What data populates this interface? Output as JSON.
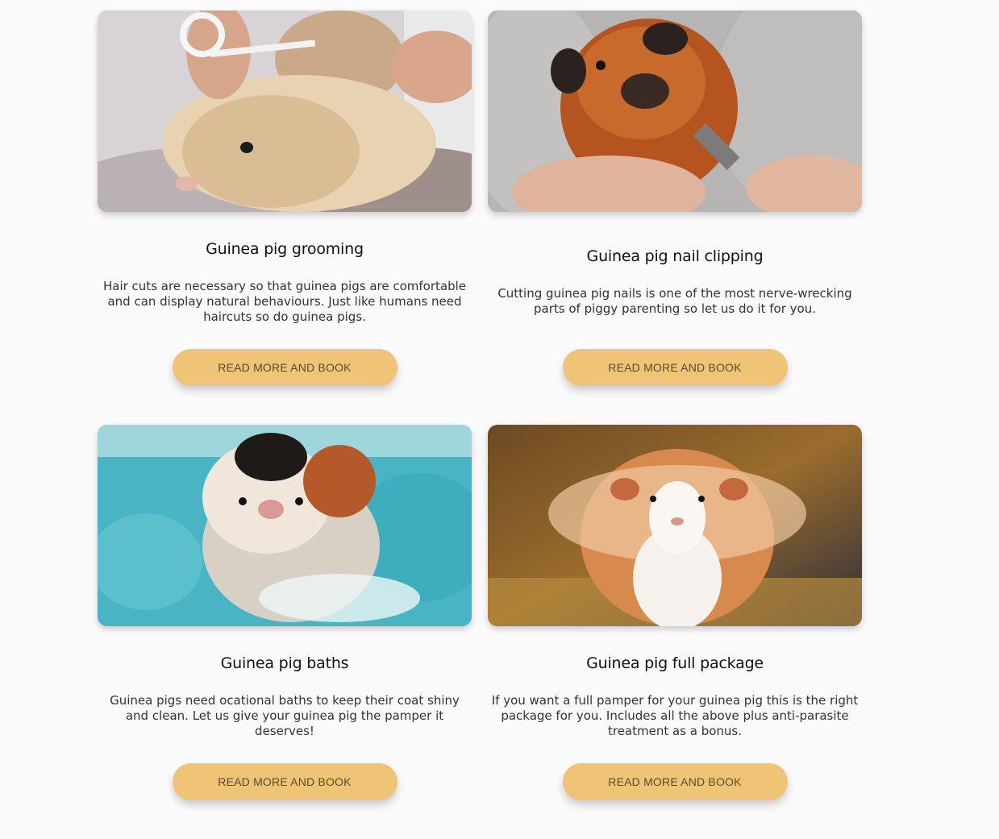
{
  "services": [
    {
      "title": "Guinea pig grooming",
      "description": "Hair cuts are necessary so that guinea pigs are comfortable and can display natural behaviours. Just like humans need haircuts so do guinea pigs.",
      "button_label": "READ MORE AND BOOK",
      "image_alt": "guinea pig grooming photo"
    },
    {
      "title": "Guinea pig nail clipping",
      "description": "Cutting guinea pig nails is one of the most nerve-wrecking parts of piggy parenting so let us do it for you.",
      "button_label": "READ MORE AND BOOK",
      "image_alt": "guinea pig nail clipping photo"
    },
    {
      "title": "Guinea pig baths",
      "description": "Guinea pigs need ocational baths to keep their coat shiny and clean. Let us give your guinea pig the pamper it deserves!",
      "button_label": "READ MORE AND BOOK",
      "image_alt": "guinea pig bath photo"
    },
    {
      "title": "Guinea pig full package",
      "description": "If you want a full pamper for your guinea pig this is the right package for you. Includes all the above plus anti-parasite treatment as a bonus.",
      "button_label": "READ MORE AND BOOK",
      "image_alt": "guinea pig full package photo"
    }
  ],
  "colors": {
    "button_bg": "#efc477",
    "page_bg": "#fafafa"
  }
}
